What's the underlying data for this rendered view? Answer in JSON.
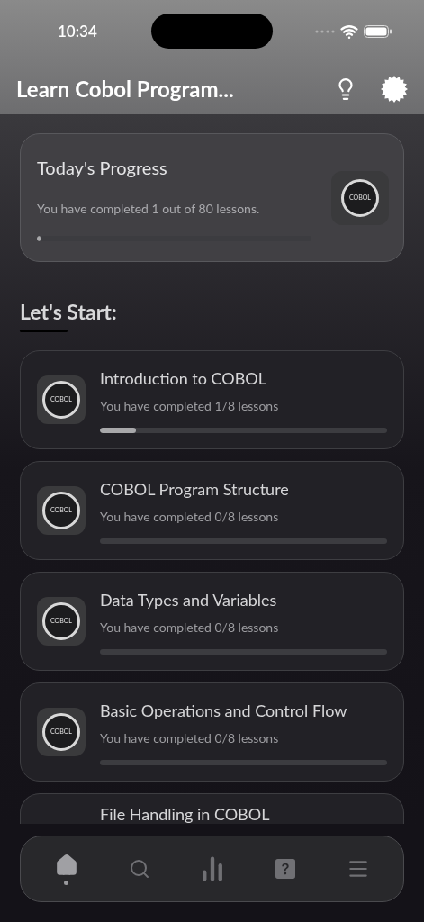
{
  "status_bar": {
    "time": "10:34"
  },
  "header": {
    "title": "Learn Cobol Program..."
  },
  "progress_card": {
    "title": "Today's Progress",
    "text": "You have completed 1 out of 80 lessons.",
    "level": 0.0125,
    "logo_text": "COBOL"
  },
  "section": {
    "title": "Let's Start:"
  },
  "courses": [
    {
      "kind": "full",
      "title": "Introduction to COBOL",
      "text": "You have completed 1/8 lessons",
      "level": 0.125,
      "logo_text": "COBOL"
    },
    {
      "kind": "full",
      "title": "COBOL Program Structure",
      "text": "You have completed 0/8 lessons",
      "level": 0,
      "logo_text": "COBOL"
    },
    {
      "kind": "full",
      "title": "Data Types and Variables",
      "text": "You have completed 0/8 lessons",
      "level": 0,
      "logo_text": "COBOL"
    },
    {
      "kind": "full",
      "title": "Basic Operations and Control Flow",
      "text": "You have completed 0/8 lessons",
      "level": 0,
      "logo_text": "COBOL"
    },
    {
      "kind": "cut",
      "title": "File Handling in COBOL"
    }
  ],
  "tab_bar": [
    {
      "kind": "home",
      "selected": true
    },
    {
      "kind": "search",
      "selected": false
    },
    {
      "kind": "stats",
      "selected": false
    },
    {
      "kind": "quiz",
      "selected": false
    },
    {
      "kind": "menu",
      "selected": false
    }
  ]
}
